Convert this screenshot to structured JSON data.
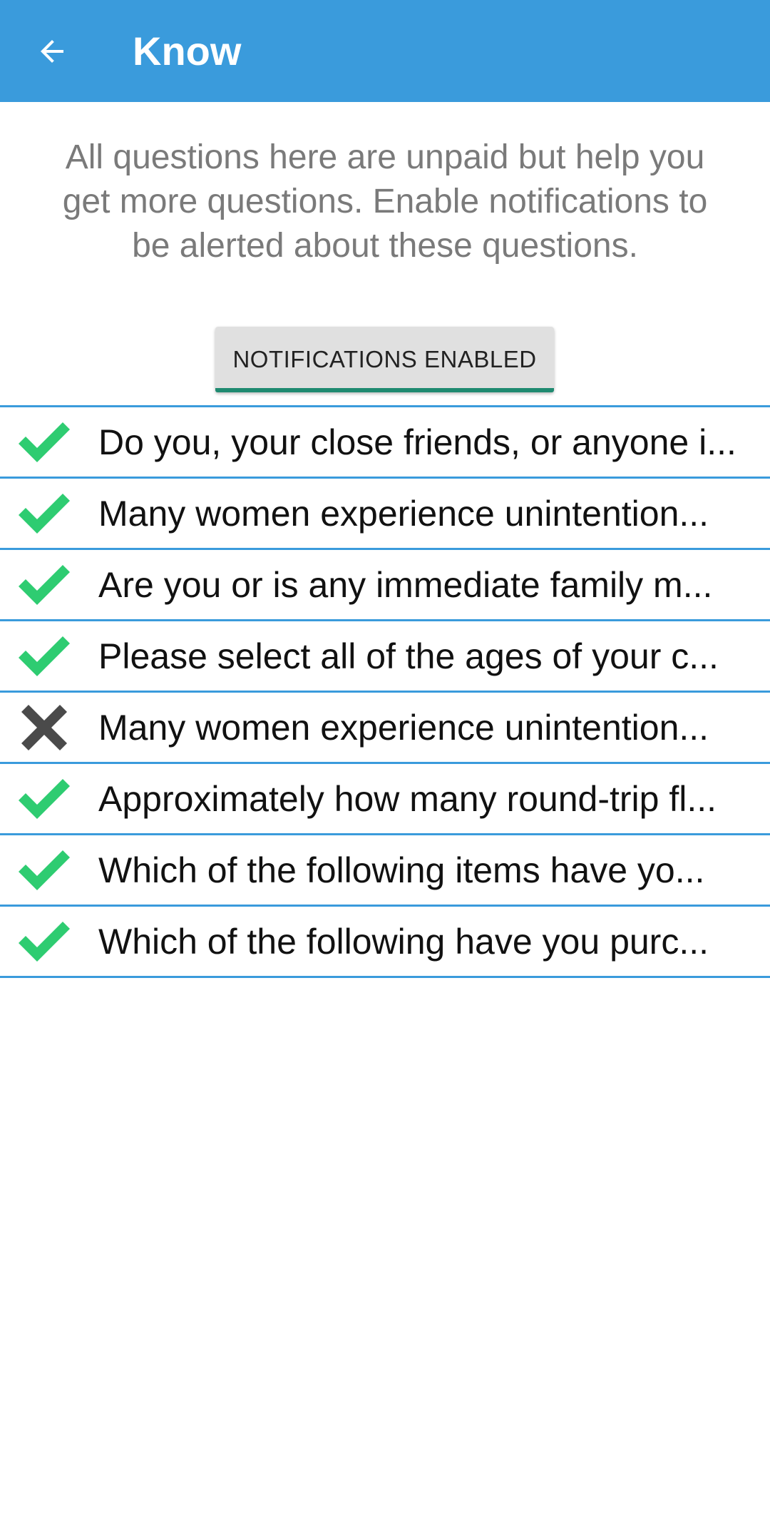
{
  "appbar": {
    "title": "Know",
    "bg_color": "#3a9bdc"
  },
  "intro": {
    "text": "All questions here are unpaid but help you get more questions. Enable notifications to be alerted about these questions."
  },
  "notifications_button": {
    "label": "NOTIFICATIONS ENABLED",
    "accent_color": "#1f8a70"
  },
  "colors": {
    "check": "#2ecc71",
    "cross": "#4a4a4a",
    "divider": "#3a9bdc"
  },
  "questions": [
    {
      "status": "done",
      "icon": "check-icon",
      "text": "Do you, your close friends, or anyone i..."
    },
    {
      "status": "done",
      "icon": "check-icon",
      "text": "Many women experience unintention..."
    },
    {
      "status": "done",
      "icon": "check-icon",
      "text": "Are you or is any immediate family m..."
    },
    {
      "status": "done",
      "icon": "check-icon",
      "text": "Please select all of the ages of your c..."
    },
    {
      "status": "declined",
      "icon": "cross-icon",
      "text": "Many women experience unintention..."
    },
    {
      "status": "done",
      "icon": "check-icon",
      "text": "Approximately how many round-trip fl..."
    },
    {
      "status": "done",
      "icon": "check-icon",
      "text": "Which of the following items have yo..."
    },
    {
      "status": "done",
      "icon": "check-icon",
      "text": "Which of the following have you purc..."
    }
  ]
}
